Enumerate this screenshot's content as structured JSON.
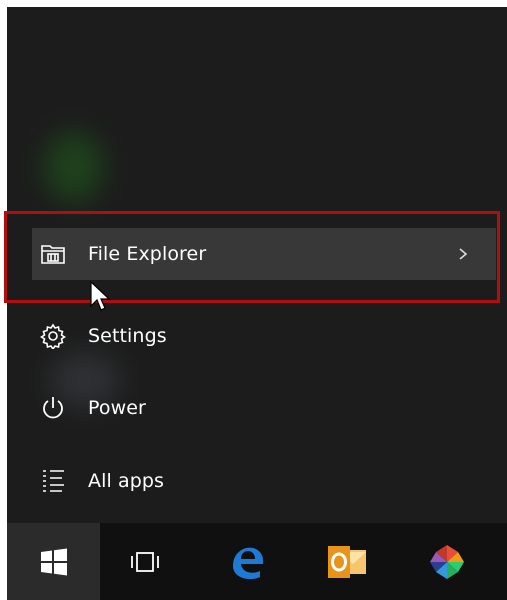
{
  "start_menu": {
    "items": [
      {
        "label": "File Explorer",
        "icon": "folder-explorer-icon",
        "has_submenu": true,
        "hovered": true
      },
      {
        "label": "Settings",
        "icon": "gear-icon",
        "has_submenu": false,
        "hovered": false
      },
      {
        "label": "Power",
        "icon": "power-icon",
        "has_submenu": false,
        "hovered": false
      },
      {
        "label": "All apps",
        "icon": "list-icon",
        "has_submenu": false,
        "hovered": false
      }
    ]
  },
  "taskbar": {
    "buttons": [
      {
        "name": "start",
        "icon": "windows-logo-icon"
      },
      {
        "name": "task-view",
        "icon": "task-view-icon"
      },
      {
        "name": "edge",
        "icon": "edge-icon"
      },
      {
        "name": "outlook",
        "icon": "outlook-icon"
      },
      {
        "name": "app",
        "icon": "gem-icon"
      }
    ]
  },
  "colors": {
    "menu_bg": "#1c1c1c",
    "hover_bg": "#383838",
    "taskbar_bg": "#101010",
    "highlight_border": "#b10e10",
    "edge_blue": "#1f7ad6",
    "outlook_orange": "#e8941a"
  }
}
